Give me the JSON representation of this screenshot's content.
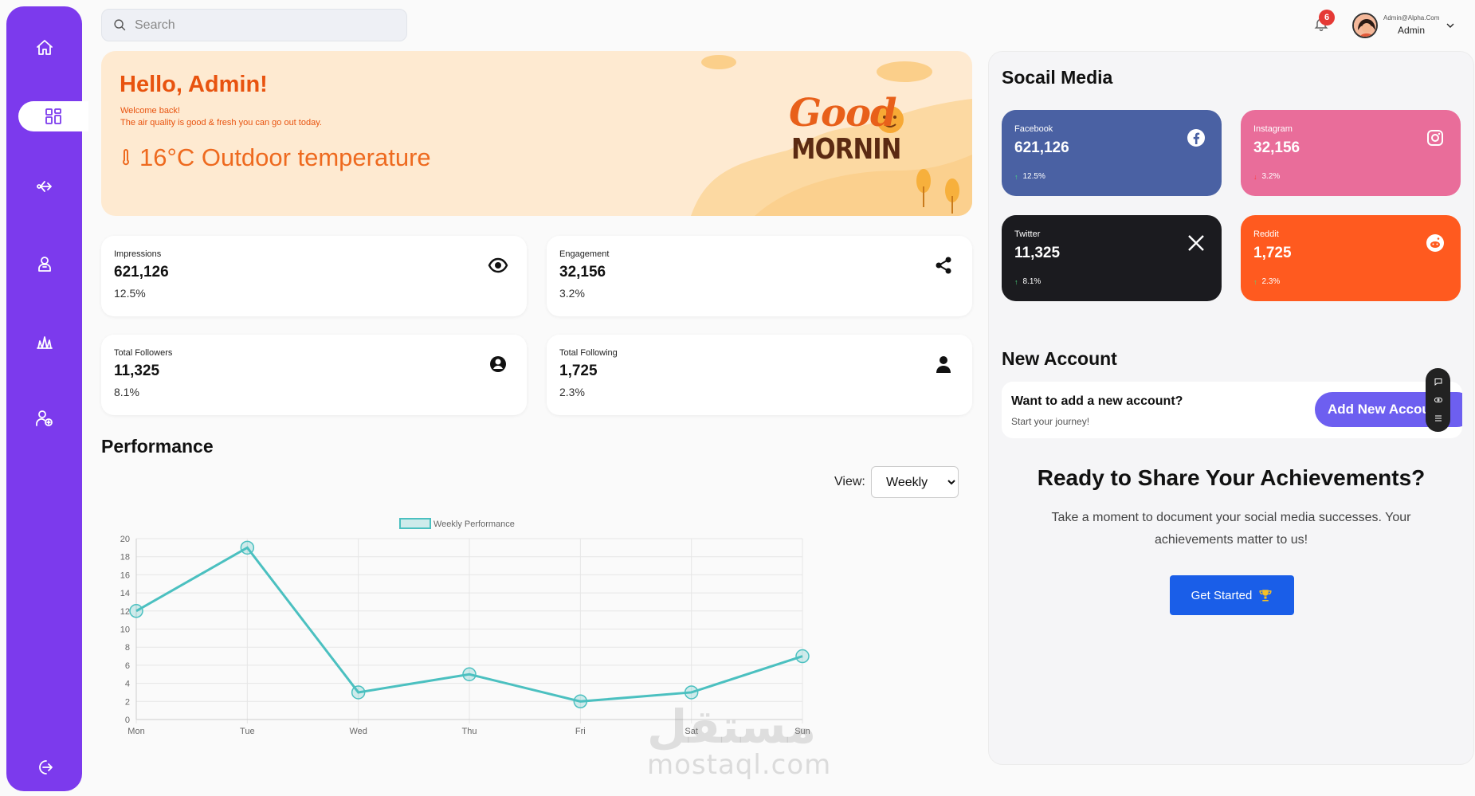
{
  "search": {
    "placeholder": "Search"
  },
  "header": {
    "notification_count": "6",
    "user_email": "Admin@Alpha.Com",
    "user_name": "Admin"
  },
  "sidebar": {
    "items": [
      {
        "name": "home",
        "icon": "home-icon",
        "active": false
      },
      {
        "name": "dashboard",
        "icon": "grid-icon",
        "active": true
      },
      {
        "name": "share",
        "icon": "share-icon",
        "active": false
      },
      {
        "name": "user",
        "icon": "user-icon",
        "active": false
      },
      {
        "name": "crystals",
        "icon": "crystals-icon",
        "active": false
      },
      {
        "name": "add-user",
        "icon": "add-user-icon",
        "active": false
      },
      {
        "name": "logout",
        "icon": "logout-icon",
        "active": false
      }
    ]
  },
  "banner": {
    "greeting": "Hello, Admin!",
    "welcome": "Welcome back!",
    "air_quality": "The air quality is good & fresh you can go out today.",
    "temperature": "16°C Outdoor temperature",
    "good": "Good",
    "morning": "MORNIN"
  },
  "stats": [
    {
      "label": "Impressions",
      "value": "621,126",
      "percent": "12.5%",
      "icon": "eye-icon"
    },
    {
      "label": "Engagement",
      "value": "32,156",
      "percent": "3.2%",
      "icon": "share-icon"
    },
    {
      "label": "Total Followers",
      "value": "11,325",
      "percent": "8.1%",
      "icon": "user-circle-icon"
    },
    {
      "label": "Total Following",
      "value": "1,725",
      "percent": "2.3%",
      "icon": "person-icon"
    }
  ],
  "performance": {
    "title": "Performance",
    "view_label": "View:",
    "view_selected": "Weekly"
  },
  "chart_data": {
    "type": "line",
    "categories": [
      "Mon",
      "Tue",
      "Wed",
      "Thu",
      "Fri",
      "Sat",
      "Sun"
    ],
    "series": [
      {
        "name": "Weekly Performance",
        "values": [
          12,
          19,
          3,
          5,
          2,
          3,
          7
        ]
      }
    ],
    "ylim": [
      0,
      20
    ],
    "yticks": [
      0,
      2,
      4,
      6,
      8,
      10,
      12,
      14,
      16,
      18,
      20
    ],
    "grid": true,
    "legend": "top-center",
    "color": "#4bc0c0"
  },
  "social": {
    "title": "Socail Media",
    "cards": [
      {
        "name": "Facebook",
        "value": "621,126",
        "percent": "12.5%",
        "trend": "up",
        "color": "#4a61a3",
        "icon": "facebook-icon"
      },
      {
        "name": "Instagram",
        "value": "32,156",
        "percent": "3.2%",
        "trend": "down",
        "color": "#e96d9a",
        "icon": "instagram-icon"
      },
      {
        "name": "Twitter",
        "value": "11,325",
        "percent": "8.1%",
        "trend": "up",
        "color": "#1b1b1f",
        "icon": "x-icon"
      },
      {
        "name": "Reddit",
        "value": "1,725",
        "percent": "2.3%",
        "trend": "up",
        "color": "#ff5a1f",
        "icon": "reddit-icon"
      }
    ]
  },
  "new_account": {
    "title": "New Account",
    "question": "Want to add a new account?",
    "subtitle": "Start your journey!",
    "button": "Add New Account"
  },
  "share": {
    "title": "Ready to Share Your Achievements?",
    "text": "Take a moment to document your social media successes. Your achievements matter to us!",
    "button": "Get Started"
  },
  "watermark": {
    "arabic": "مستقل",
    "latin": "mostaql.com"
  }
}
